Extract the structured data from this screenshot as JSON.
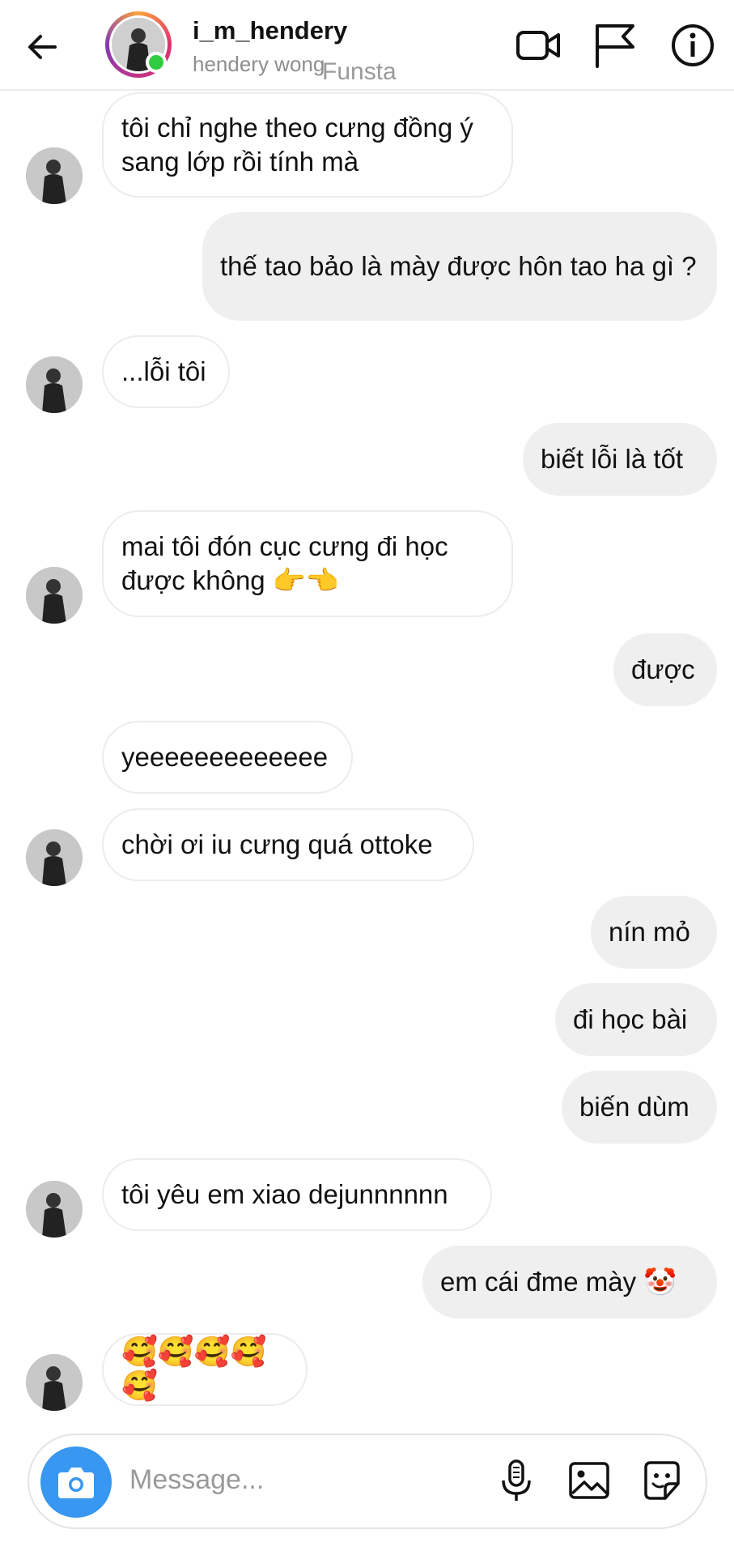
{
  "header": {
    "username": "i_m_hendery",
    "full_name": "hendery wong",
    "watermark": "Funsta",
    "icons": [
      "back-arrow-icon",
      "video-call-icon",
      "flag-icon",
      "info-icon"
    ]
  },
  "messages": [
    {
      "from": "them",
      "text": "tôi chỉ nghe theo cưng đồng ý sang lớp rồi tính mà"
    },
    {
      "from": "me",
      "text": "thế tao bảo là mày được hôn tao ha gì ?"
    },
    {
      "from": "them",
      "text": "...lỗi tôi"
    },
    {
      "from": "me",
      "text": "biết lỗi là tốt"
    },
    {
      "from": "them",
      "text": "mai tôi đón cục cưng đi học được không 👉👈"
    },
    {
      "from": "me",
      "text": "được"
    },
    {
      "from": "them",
      "text": "yeeeeeeeeeeeee"
    },
    {
      "from": "them",
      "text": "chời ơi iu cưng quá ottoke"
    },
    {
      "from": "me",
      "text": "nín mỏ"
    },
    {
      "from": "me",
      "text": "đi học bài"
    },
    {
      "from": "me",
      "text": "biến dùm"
    },
    {
      "from": "them",
      "text": "tôi yêu em xiao dejunnnnnn"
    },
    {
      "from": "me",
      "text": "em cái đme mày 🤡"
    },
    {
      "from": "them",
      "text": "🥰🥰🥰🥰🥰"
    }
  ],
  "composer": {
    "placeholder": "Message...",
    "icons": [
      "camera-icon",
      "microphone-icon",
      "gallery-icon",
      "sticker-icon"
    ]
  },
  "colors": {
    "accent": "#3897f0",
    "online": "#2ecc40",
    "outgoing_bubble": "#efefef",
    "incoming_border": "#ececec"
  }
}
